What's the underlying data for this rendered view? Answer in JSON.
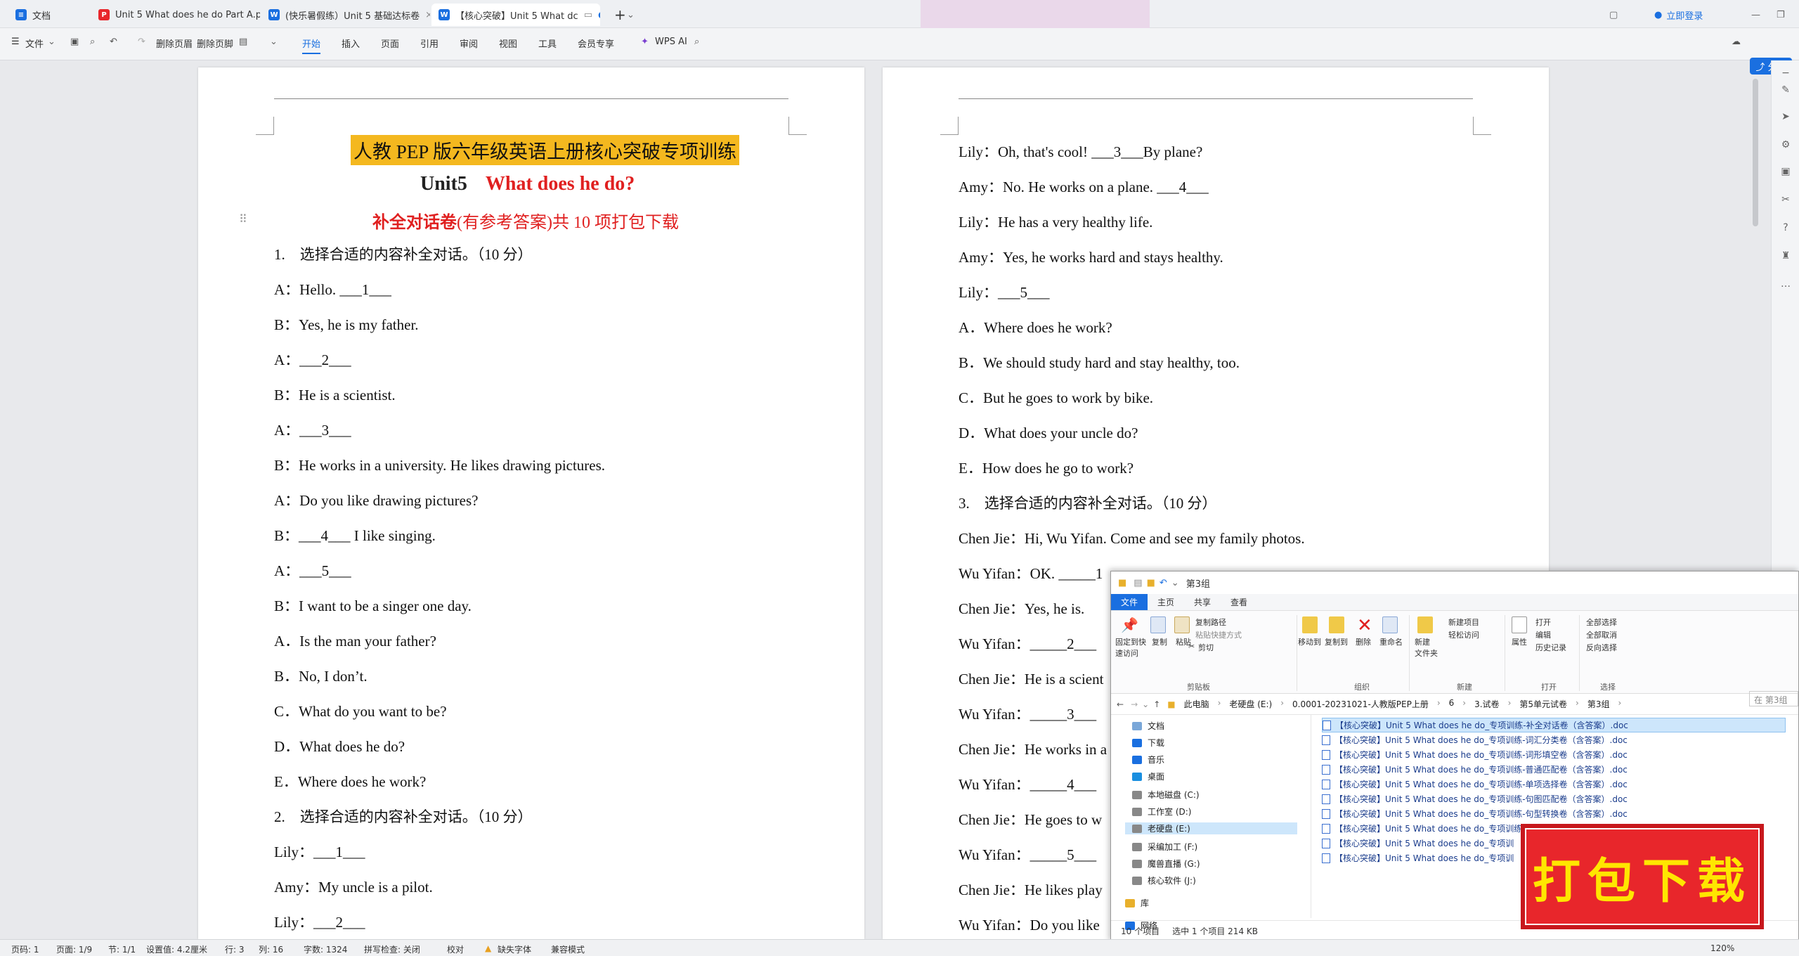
{
  "titlebar": {
    "tabs": [
      {
        "label": "文档",
        "icon": "doc-home-icon",
        "color": "#1a6fe0"
      },
      {
        "label": "Unit 5 What does he do Part A.pdf",
        "icon": "pdf-icon",
        "color": "#e8262b"
      },
      {
        "label": "(快乐暑假练）Unit 5 基础达标卷",
        "icon": "word-icon",
        "color": "#1a6fe0"
      },
      {
        "label": "【核心突破】Unit 5 What dc",
        "icon": "word-icon",
        "color": "#1a6fe0"
      }
    ],
    "login": "立即登录"
  },
  "toolbar": {
    "file": "文件",
    "delete_header": "删除页眉",
    "delete_footer": "删除页脚",
    "tabs": [
      "开始",
      "插入",
      "页面",
      "引用",
      "审阅",
      "视图",
      "工具",
      "会员专享"
    ],
    "active_tab": "开始",
    "wps_ai": "WPS AI",
    "share": "分享"
  },
  "page1": {
    "title1": "人教 PEP 版六年级英语上册核心突破专项训练",
    "title2_unit": "Unit5",
    "title2_red": "What does he do?",
    "title3_bold": "补全对话卷",
    "title3_rest": "(有参考答案)共 10 项打包下载",
    "lines": [
      "1.　选择合适的内容补全对话。（10 分）",
      "A：Hello. ___1___",
      "B：Yes, he is my father.",
      "A：___2___",
      "B：He is a scientist.",
      "A：___3___",
      "B：He works in a university. He likes drawing pictures.",
      "A：Do you like drawing pictures?",
      "B：___4___ I like singing.",
      "A：___5___",
      "B：I want to be a singer one day.",
      "A．Is the man your father?",
      "B．No, I don’t.",
      "C．What do you want to be?",
      "D．What does he do?",
      "E．Where does he work?",
      "2.　选择合适的内容补全对话。（10 分）",
      "Lily：___1___",
      "Amy：My uncle is a pilot.",
      "Lily：___2___"
    ]
  },
  "page2": {
    "lines": [
      "Lily：Oh, that's cool! ___3___By plane?",
      "Amy：No. He works on a plane. ___4___",
      "Lily：He has a very healthy life.",
      "Amy：Yes, he works hard and stays healthy.",
      "Lily：___5___",
      "A．Where does he work?",
      "B．We should study hard and stay healthy, too.",
      "C．But he goes to work by bike.",
      "D．What does your uncle do?",
      "E．How does he go to work?",
      "3.　选择合适的内容补全对话。（10 分）",
      "Chen Jie：Hi, Wu Yifan. Come and see my family photos.",
      "Wu Yifan：OK. _____1",
      "Chen Jie：Yes, he is.",
      "Wu Yifan：_____2___",
      "Chen Jie：He is a scient",
      "Wu Yifan：_____3___",
      "Chen Jie：He works in a",
      "Wu Yifan：_____4___",
      "Chen Jie：He goes to w",
      "Wu Yifan：_____5___",
      "Chen Jie：He likes play",
      "Wu Yifan：Do you like"
    ]
  },
  "explorer": {
    "title": "第3组",
    "tabs": [
      "文件",
      "主页",
      "共享",
      "查看"
    ],
    "ribbon": {
      "pin": "固定到快\n速访问",
      "copy": "复制",
      "paste": "粘贴",
      "copy_path": "复制路径",
      "paste_shortcut": "粘贴快捷方式",
      "cut": "剪切",
      "move_to": "移动到",
      "copy_to": "复制到",
      "delete": "删除",
      "rename": "重命名",
      "new_folder": "新建\n文件夹",
      "new_item": "新建项目",
      "easy_access": "轻松访问",
      "properties": "属性",
      "open": "打开",
      "edit": "编辑",
      "history": "历史记录",
      "select_all": "全部选择",
      "select_none": "全部取消",
      "invert": "反向选择",
      "groups": [
        "剪贴板",
        "组织",
        "新建",
        "打开",
        "选择"
      ]
    },
    "breadcrumb": [
      "此电脑",
      "老硬盘 (E:)",
      "0.0001-20231021-人教版PEP上册",
      "6",
      "3.试卷",
      "第5单元试卷",
      "第3组"
    ],
    "search": "在 第3组",
    "nav": [
      {
        "label": "文档",
        "icon": "documents-icon"
      },
      {
        "label": "下载",
        "icon": "download-icon"
      },
      {
        "label": "音乐",
        "icon": "music-icon"
      },
      {
        "label": "桌面",
        "icon": "desktop-icon"
      },
      {
        "label": "本地磁盘 (C:)",
        "icon": "drive-icon"
      },
      {
        "label": "工作室 (D:)",
        "icon": "drive-icon"
      },
      {
        "label": "老硬盘 (E:)",
        "icon": "drive-icon"
      },
      {
        "label": "采编加工 (F:)",
        "icon": "drive-icon"
      },
      {
        "label": "魔兽直播 (G:)",
        "icon": "drive-icon"
      },
      {
        "label": "核心软件 (J:)",
        "icon": "drive-icon"
      },
      {
        "label": "库",
        "icon": "library-icon"
      },
      {
        "label": "网络",
        "icon": "network-icon"
      }
    ],
    "files": [
      "【核心突破】Unit 5 What does he do_专项训练-补全对话卷（含答案）.doc",
      "【核心突破】Unit 5 What does he do_专项训练-词汇分类卷（含答案）.doc",
      "【核心突破】Unit 5 What does he do_专项训练-词形填空卷（含答案）.doc",
      "【核心突破】Unit 5 What does he do_专项训练-普通匹配卷（含答案）.doc",
      "【核心突破】Unit 5 What does he do_专项训练-单项选择卷（含答案）.doc",
      "【核心突破】Unit 5 What does he do_专项训练-句图匹配卷（含答案）.doc",
      "【核心突破】Unit 5 What does he do_专项训练-句型转换卷（含答案）.doc",
      "【核心突破】Unit 5 What does he do_专项训练-连词成句卷（含答案）.doc",
      "【核心突破】Unit 5 What does he do_专项训",
      "【核心突破】Unit 5 What does he do_专项训"
    ],
    "status_count": "10 个项目",
    "status_selected": "选中 1 个项目  214 KB"
  },
  "badge": "打包下载",
  "statusbar": {
    "page": "页码: 1",
    "pages": "页面: 1/9",
    "section": "节: 1/1",
    "setting": "设置值: 4.2厘米",
    "row": "行: 3",
    "col": "列: 16",
    "words": "字数: 1324",
    "spell": "拼写检查: 关闭",
    "proof": "校对",
    "missing_font": "缺失字体",
    "compat": "兼容模式",
    "zoom": "120%"
  }
}
